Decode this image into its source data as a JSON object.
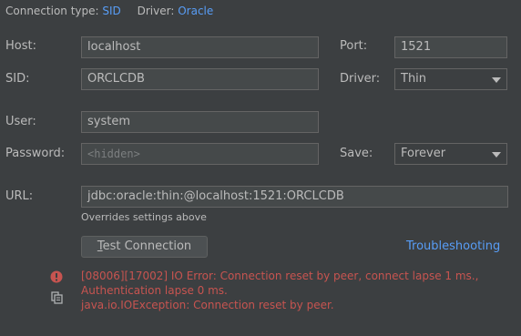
{
  "header": {
    "connection_type_label": "Connection type:",
    "connection_type_value": "SID",
    "driver_label": "Driver:",
    "driver_value": "Oracle"
  },
  "form": {
    "host_label": "Host:",
    "host_value": "localhost",
    "port_label": "Port:",
    "port_value": "1521",
    "sid_label": "SID:",
    "sid_value": "ORCLCDB",
    "driver_label": "Driver:",
    "driver_value": "Thin",
    "user_label": "User:",
    "user_value": "system",
    "password_label": "Password:",
    "password_placeholder": "<hidden>",
    "save_label": "Save:",
    "save_value": "Forever",
    "url_label": "URL:",
    "url_value": "jdbc:oracle:thin:@localhost:1521:ORCLCDB",
    "url_hint": "Overrides settings above"
  },
  "actions": {
    "test_connection_label": "Test Connection",
    "test_connection_mnemonic": "T",
    "troubleshooting_label": "Troubleshooting"
  },
  "error": {
    "line1": "[08006][17002] IO Error: Connection reset by peer, connect lapse 1 ms.,",
    "line2": "Authentication lapse 0 ms.",
    "line3": "java.io.IOException: Connection reset by peer."
  },
  "colors": {
    "background": "#3c3f41",
    "link": "#589df6",
    "error": "#c75450"
  }
}
